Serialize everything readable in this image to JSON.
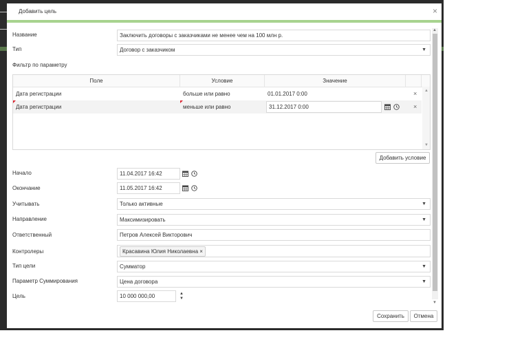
{
  "dialog": {
    "title": "Добавить цель",
    "close_glyph": "×"
  },
  "form": {
    "name": {
      "label": "Название",
      "value": "Заключить договоры с заказчиками не менее чем на 100 млн р."
    },
    "type": {
      "label": "Тип",
      "value": "Договор с заказчиком"
    },
    "filter": {
      "label": "Фильтр по параметру",
      "columns": [
        "Поле",
        "Условие",
        "Значение"
      ],
      "rows": [
        {
          "field": "Дата регистрации",
          "condition": "больше или равно",
          "value": "01.01.2017 0:00"
        },
        {
          "field": "Дата регистрации",
          "condition": "меньше или равно",
          "value": "31.12.2017 0:00"
        }
      ],
      "delete_glyph": "×",
      "add_condition": "Добавить условие"
    },
    "start": {
      "label": "Начало",
      "value": "11.04.2017 16:42"
    },
    "end": {
      "label": "Окончание",
      "value": "11.05.2017 16:42"
    },
    "account": {
      "label": "Учитывать",
      "value": "Только активные"
    },
    "direction": {
      "label": "Направление",
      "value": "Максимизировать"
    },
    "responsible": {
      "label": "Ответственный",
      "value": "Петров Алексей Викторович"
    },
    "controllers": {
      "label": "Контролеры",
      "tag": "Красавина Юлия Николаевна",
      "tag_remove": "×"
    },
    "goal_type": {
      "label": "Тип цели",
      "value": "Сумматор"
    },
    "sum_param": {
      "label": "Параметр Суммирования",
      "value": "Цена договора"
    },
    "goal": {
      "label": "Цель",
      "value": "10 000 000,00"
    }
  },
  "footer": {
    "save": "Сохранить",
    "cancel": "Отмена"
  },
  "icons": {
    "dropdown": "▼",
    "spin_up": "▲",
    "spin_down": "▼",
    "scroll_up": "▲",
    "scroll_down": "▼"
  },
  "colors": {
    "accent_bar": "#a8d38f",
    "required_marker": "#d9232f",
    "backdrop": "#2b2b2b"
  }
}
